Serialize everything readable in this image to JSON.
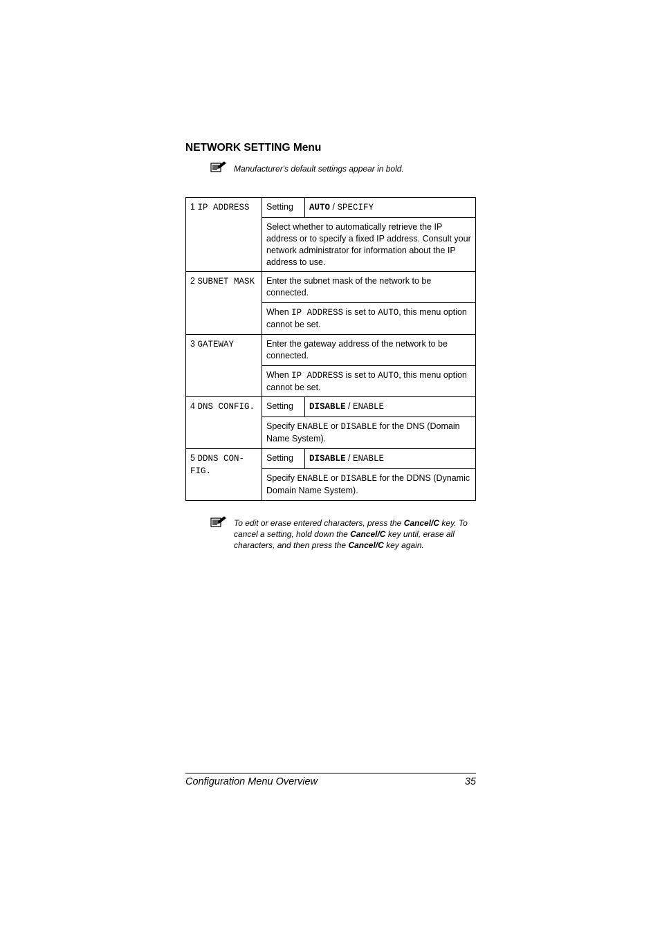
{
  "heading": "NETWORK SETTING Menu",
  "intro_note": "Manufacturer's default settings appear in bold.",
  "rows": {
    "r1": {
      "label_num": "1 ",
      "label_mono": "IP ADDRESS",
      "setting_word": "Setting",
      "val_bold": "AUTO",
      "val_sep": " / ",
      "val_plain": "SPECIFY",
      "desc": "Select whether to automatically retrieve the IP address or to specify a fixed IP address. Consult your network administrator for information about the IP address to use."
    },
    "r2": {
      "label_num": "2 ",
      "label_mono": "SUBNET MASK",
      "desc_a": "Enter the subnet mask of the network to be connected.",
      "desc_b_pre": "When ",
      "desc_b_m1": "IP ADDRESS",
      "desc_b_mid": " is set to ",
      "desc_b_m2": "AUTO",
      "desc_b_post": ", this menu option cannot be set."
    },
    "r3": {
      "label_num": "3 ",
      "label_mono": "GATEWAY",
      "desc_a": "Enter the gateway address of the network to be connected.",
      "desc_b_pre": "When ",
      "desc_b_m1": "IP ADDRESS",
      "desc_b_mid": " is set to ",
      "desc_b_m2": "AUTO",
      "desc_b_post": ", this menu option cannot be set."
    },
    "r4": {
      "label_num": "4 ",
      "label_mono": "DNS CONFIG.",
      "setting_word": "Setting",
      "val_bold": "DISABLE",
      "val_sep": " / ",
      "val_plain": "ENABLE",
      "desc_pre": "Specify ",
      "desc_m1": "ENABLE",
      "desc_or": " or ",
      "desc_m2": "DISABLE",
      "desc_post": " for the DNS (Domain Name System)."
    },
    "r5": {
      "label_num": "5 ",
      "label_mono1": "DDNS CON-",
      "label_mono2": "FIG.",
      "setting_word": "Setting",
      "val_bold": "DISABLE",
      "val_sep": " / ",
      "val_plain": "ENABLE",
      "desc_pre": "Specify ",
      "desc_m1": "ENABLE",
      "desc_or": " or ",
      "desc_m2": "DISABLE",
      "desc_post": " for the DDNS (Dynamic Domain Name System)."
    }
  },
  "footnote": {
    "a": "To edit or erase entered characters, press the ",
    "k1": "Cancel/C",
    "b": " key. To cancel a setting, hold down the ",
    "k2": "Cancel/C",
    "c": " key until, erase all characters, and then press the ",
    "k3": "Cancel/C",
    "d": " key again."
  },
  "footer_left": "Configuration Menu Overview",
  "footer_right": "35"
}
